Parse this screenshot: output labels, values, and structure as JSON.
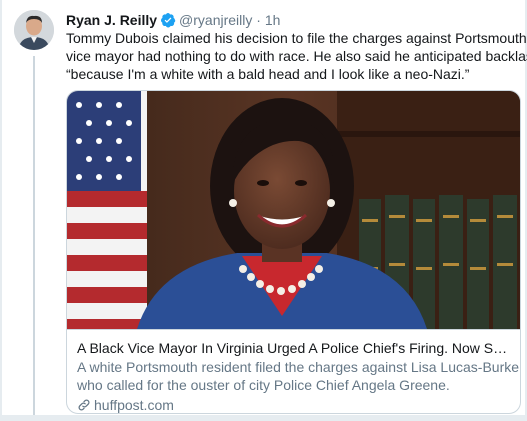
{
  "tweet": {
    "author_name": "Ryan J. Reilly",
    "handle": "@ryanjreilly",
    "separator": "·",
    "time": "1h",
    "text_lines": [
      "Tommy Dubois claimed his decision to file the charges against Portsmouth's",
      "vice mayor had nothing to do with race. He also said he anticipated backlash",
      "“because I'm a white with a bald head and I look like a neo-Nazi.”"
    ]
  },
  "card": {
    "title": "A Black Vice Mayor In Virginia Urged A Police Chief's Firing. Now She Fa...",
    "description_lines": [
      "A white Portsmouth resident filed the charges against Lisa Lucas-Burke,",
      "who called for the ouster of city Police Chief Angela Greene."
    ],
    "domain": "huffpost.com"
  },
  "colors": {
    "verified_badge": "#1da1f2",
    "secondary_text": "#657786",
    "border": "#ccd6dd",
    "blazer": "#2b4f96",
    "bookshelf": "#4a2b1c"
  },
  "icons": {
    "verified": "verified-badge-icon",
    "link": "link-icon"
  }
}
